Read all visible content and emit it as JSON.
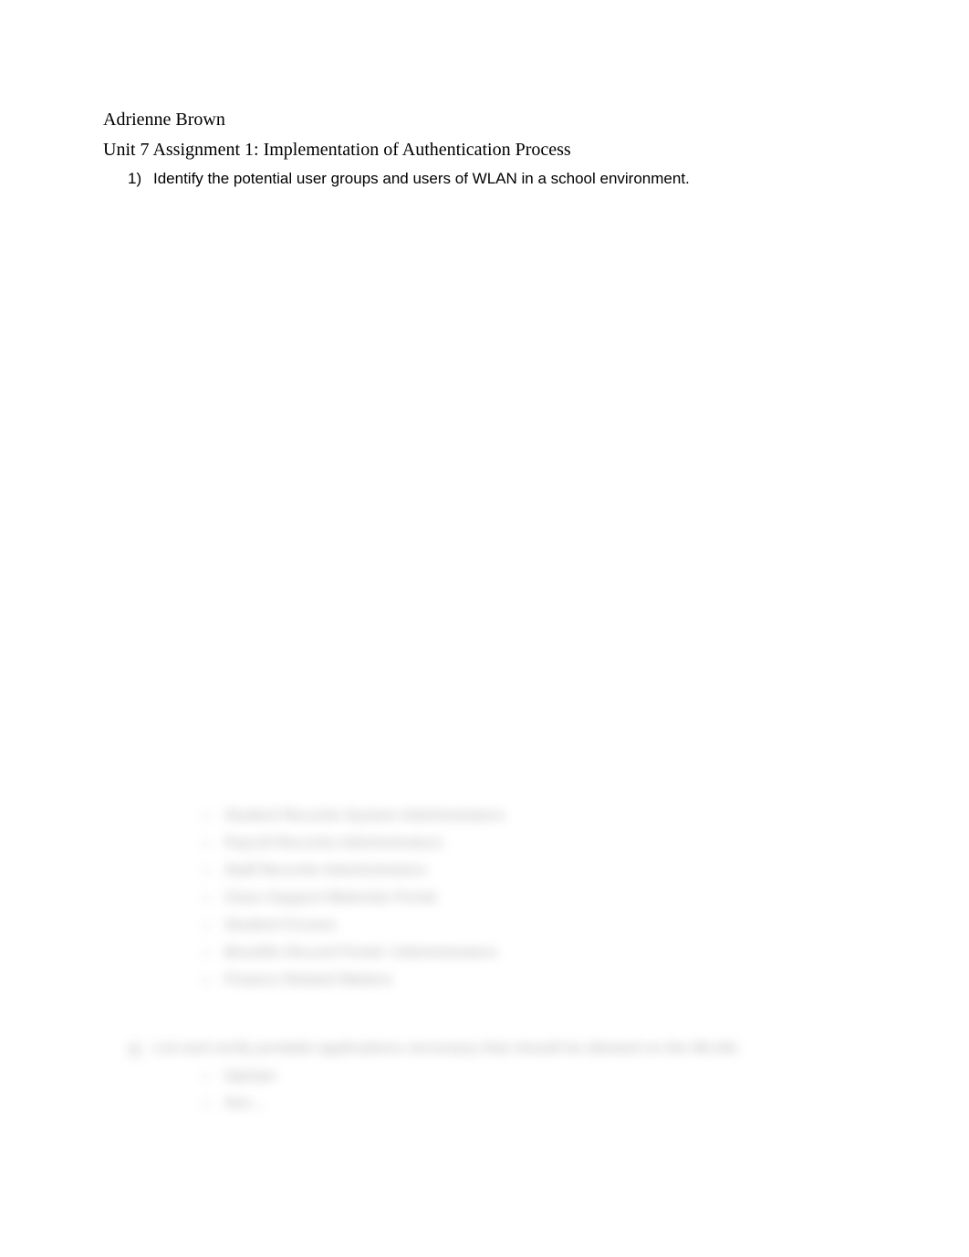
{
  "author": "Adrienne Brown",
  "title": "Unit 7 Assignment 1: Implementation of Authentication Process",
  "question1": {
    "number": "1)",
    "text": "Identify the potential user groups and users of WLAN in a school environment."
  },
  "blurredList1": [
    "Student Records System Administrators",
    "Payroll Records Administrators",
    "Staff Records Administrators",
    "Class Support Materials Portal",
    "Student Forums",
    "Benefits Record Portal / Administrators",
    "Finance Related Matters"
  ],
  "question2": {
    "number": "2)",
    "text": "List and verify portable applications necessary that should be allowed on the WLAN."
  },
  "blurredList2": [
    "laptops",
    "See…"
  ]
}
